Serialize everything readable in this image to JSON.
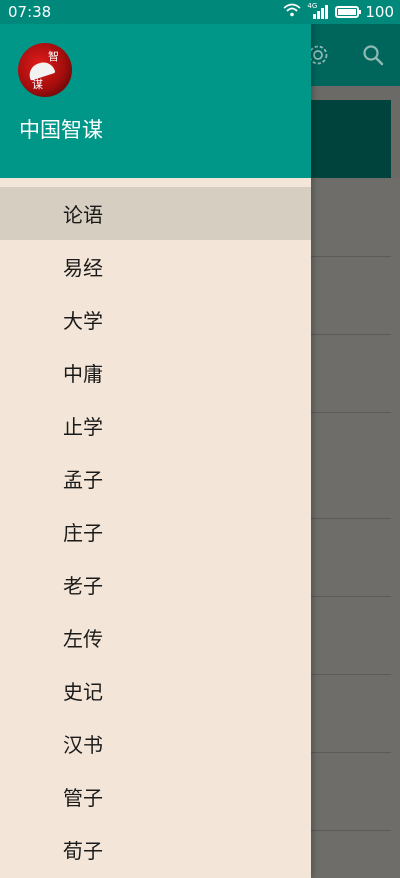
{
  "status_bar": {
    "time": "07:38",
    "battery": "100",
    "network": "4G",
    "icons": [
      "wifi-icon",
      "signal-icon",
      "battery-icon"
    ]
  },
  "drawer": {
    "app_name": "中国智谋",
    "avatar_chars": [
      "智",
      "谋"
    ],
    "selected_index": 0,
    "items": [
      {
        "label": "论语"
      },
      {
        "label": "易经"
      },
      {
        "label": "大学"
      },
      {
        "label": "中庸"
      },
      {
        "label": "止学"
      },
      {
        "label": "孟子"
      },
      {
        "label": "庄子"
      },
      {
        "label": "老子"
      },
      {
        "label": "左传"
      },
      {
        "label": "史记"
      },
      {
        "label": "汉书"
      },
      {
        "label": "管子"
      },
      {
        "label": "荀子"
      }
    ]
  },
  "toolbar": {
    "icons": [
      "settings-icon",
      "search-icon"
    ]
  },
  "colors": {
    "primary": "#009688",
    "status_bar": "#00897b",
    "drawer_bg": "#f3e6d8",
    "selected_bg": "#d7cec2",
    "scrim": "#6b6a66"
  }
}
